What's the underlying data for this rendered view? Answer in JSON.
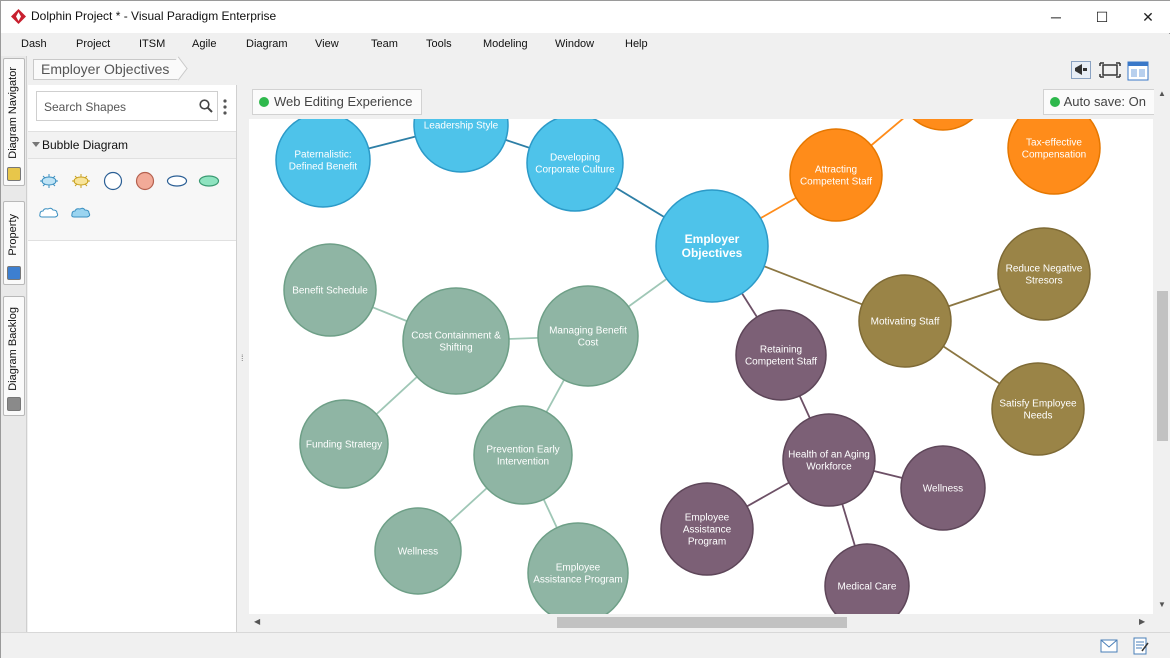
{
  "window": {
    "title": "Dolphin Project * - Visual Paradigm Enterprise",
    "minimize": "─",
    "maximize": "☐",
    "close": "✕"
  },
  "menu": [
    "Dash",
    "Project",
    "ITSM",
    "Agile",
    "Diagram",
    "View",
    "Team",
    "Tools",
    "Modeling",
    "Window",
    "Help"
  ],
  "left_tabs": {
    "navigator": "Diagram Navigator",
    "property": "Property",
    "backlog": "Diagram Backlog"
  },
  "breadcrumb": "Employer Objectives",
  "shape_panel": {
    "search_placeholder": "Search Shapes",
    "category": "Bubble Diagram",
    "palette_icons": [
      "bubble-burst-icon",
      "bubble-burst-yellow-icon",
      "circle-outline-icon",
      "circle-filled-icon",
      "ellipse-outline-icon",
      "ellipse-filled-icon",
      "cloud-outline-icon",
      "cloud-filled-icon"
    ]
  },
  "canvas": {
    "web_editing": "Web Editing Experience",
    "autosave": "Auto save: On"
  },
  "colors": {
    "blue": "#4ec3ea",
    "blue_stroke": "#2c9ac8",
    "orange": "#ff8c1a",
    "orange_stroke": "#e57700",
    "olive": "#9a8447",
    "olive_stroke": "#7e6a35",
    "plum": "#7c6076",
    "plum_stroke": "#5e4659",
    "sage": "#8fb5a4",
    "sage_stroke": "#6e9f87"
  },
  "bubbles": [
    {
      "id": "employer",
      "label": [
        "Employer",
        "Objectives"
      ],
      "color": "blue",
      "big": true
    },
    {
      "id": "leadership",
      "label": [
        "Leadership Style"
      ],
      "color": "blue"
    },
    {
      "id": "paternalistic",
      "label": [
        "Paternalistic:",
        "Defined Benefit"
      ],
      "color": "blue"
    },
    {
      "id": "developing",
      "label": [
        "Developing",
        "Corporate Culture"
      ],
      "color": "blue"
    },
    {
      "id": "attracting",
      "label": [
        "Attracting",
        "Competent Staff"
      ],
      "color": "orange"
    },
    {
      "id": "orange_top",
      "label": [],
      "color": "orange"
    },
    {
      "id": "taxeffective",
      "label": [
        "Tax-effective",
        "Compensation"
      ],
      "color": "orange"
    },
    {
      "id": "motivating",
      "label": [
        "Motivating Staff"
      ],
      "color": "olive"
    },
    {
      "id": "reduce",
      "label": [
        "Reduce Negative",
        "Stresors"
      ],
      "color": "olive"
    },
    {
      "id": "satisfy",
      "label": [
        "Satisfy Employee",
        "Needs"
      ],
      "color": "olive"
    },
    {
      "id": "retaining",
      "label": [
        "Retaining",
        "Competent Staff"
      ],
      "color": "plum"
    },
    {
      "id": "aging",
      "label": [
        "Health of an Aging",
        "Workforce"
      ],
      "color": "plum"
    },
    {
      "id": "wellness_p",
      "label": [
        "Wellness"
      ],
      "color": "plum"
    },
    {
      "id": "eap_p",
      "label": [
        "Employee",
        "Assistance",
        "Program"
      ],
      "color": "plum"
    },
    {
      "id": "medical",
      "label": [
        "Medical Care"
      ],
      "color": "plum"
    },
    {
      "id": "managing",
      "label": [
        "Managing Benefit",
        "Cost"
      ],
      "color": "sage"
    },
    {
      "id": "containment",
      "label": [
        "Cost Containment &",
        "Shifting"
      ],
      "color": "sage"
    },
    {
      "id": "benefit_schedule",
      "label": [
        "Benefit Schedule"
      ],
      "color": "sage"
    },
    {
      "id": "funding",
      "label": [
        "Funding Strategy"
      ],
      "color": "sage"
    },
    {
      "id": "prevention",
      "label": [
        "Prevention Early",
        "Intervention"
      ],
      "color": "sage"
    },
    {
      "id": "wellness_s",
      "label": [
        "Wellness"
      ],
      "color": "sage"
    },
    {
      "id": "eap_s",
      "label": [
        "Employee",
        "Assistance Program"
      ],
      "color": "sage"
    }
  ],
  "edges": [
    [
      "employer",
      "developing"
    ],
    [
      "developing",
      "leadership"
    ],
    [
      "leadership",
      "paternalistic"
    ],
    [
      "employer",
      "attracting"
    ],
    [
      "attracting",
      "orange_top"
    ],
    [
      "employer",
      "motivating"
    ],
    [
      "motivating",
      "reduce"
    ],
    [
      "motivating",
      "satisfy"
    ],
    [
      "employer",
      "retaining"
    ],
    [
      "retaining",
      "aging"
    ],
    [
      "aging",
      "wellness_p"
    ],
    [
      "aging",
      "eap_p"
    ],
    [
      "aging",
      "medical"
    ],
    [
      "employer",
      "managing"
    ],
    [
      "managing",
      "containment"
    ],
    [
      "containment",
      "benefit_schedule"
    ],
    [
      "containment",
      "funding"
    ],
    [
      "managing",
      "prevention"
    ],
    [
      "prevention",
      "wellness_s"
    ],
    [
      "prevention",
      "eap_s"
    ]
  ]
}
